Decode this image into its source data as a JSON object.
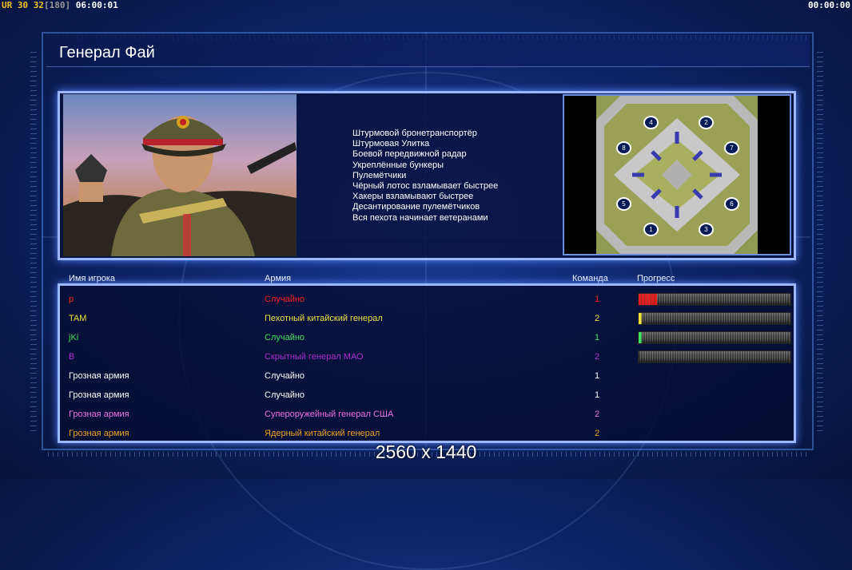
{
  "hud": {
    "mode": "UR",
    "fps": "30",
    "fps2": "32",
    "fps_cap": "[180]",
    "time_left": "06:00:01",
    "time_right": "00:00:00"
  },
  "screen": {
    "title": "Генерал Фай"
  },
  "general": {
    "features": [
      "Штурмовой бронетранспортёр",
      "Штурмовая Улитка",
      "Боевой передвижной радар",
      "Укреплённые бункеры",
      "Пулемётчики",
      "Чёрный лотос взламывает быстрее",
      "Хакеры взламывают быстрее",
      "Десантирование пулемётчиков",
      "Вся пехота начинает ветеранами"
    ]
  },
  "minimap": {
    "spawns": [
      "4",
      "2",
      "8",
      "7",
      "5",
      "6",
      "1",
      "3"
    ]
  },
  "table": {
    "headers": {
      "name": "Имя игрока",
      "army": "Армия",
      "team": "Команда",
      "progress": "Прогресс"
    },
    "rows": [
      {
        "name": "р",
        "army": "Случайно",
        "team": "1",
        "color": "#ff2020",
        "progress": 0.12,
        "bar_color": "#e02020"
      },
      {
        "name": "TAM",
        "army": "Пехотный китайский генерал",
        "team": "2",
        "color": "#f0e040",
        "progress": 0.02,
        "bar_color": "#f0e040"
      },
      {
        "name": "jKi",
        "army": "Случайно",
        "team": "1",
        "color": "#40e060",
        "progress": 0.02,
        "bar_color": "#40e060"
      },
      {
        "name": "B",
        "army": "Скрытный генерал МАО",
        "team": "2",
        "color": "#b030d0",
        "progress": 0.0,
        "bar_color": "#b030d0"
      },
      {
        "name": "Грозная армия",
        "army": "Случайно",
        "team": "1",
        "color": "#ffffff"
      },
      {
        "name": "Грозная армия",
        "army": "Случайно",
        "team": "1",
        "color": "#ffffff"
      },
      {
        "name": "Грозная армия",
        "army": "Супероружейный генерал США",
        "team": "2",
        "color": "#f070e0"
      },
      {
        "name": "Грозная армия",
        "army": "Ядерный китайский генерал",
        "team": "2",
        "color": "#f0a020"
      }
    ]
  },
  "overlay": {
    "resolution": "2560 x 1440"
  }
}
